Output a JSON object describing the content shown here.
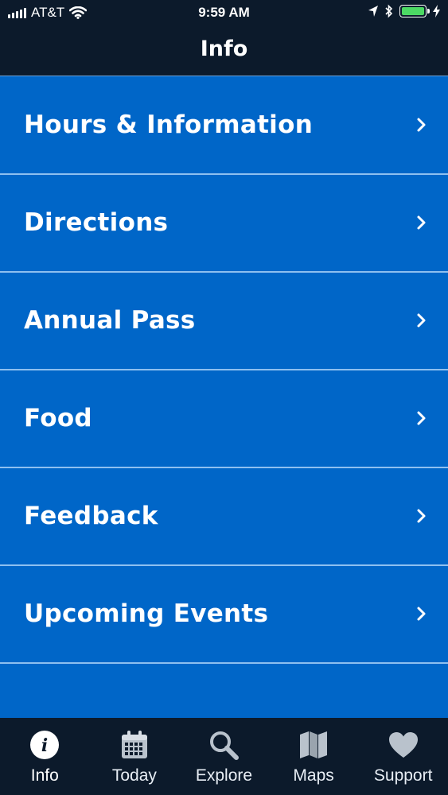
{
  "status_bar": {
    "carrier": "AT&T",
    "time": "9:59 AM",
    "battery_color": "#4cd964",
    "icons": [
      "signal-bars-icon",
      "wifi-icon",
      "location-arrow-icon",
      "bluetooth-icon",
      "battery-icon",
      "charging-bolt-icon"
    ]
  },
  "nav": {
    "title": "Info"
  },
  "menu": {
    "items": [
      {
        "label": "Hours & Information"
      },
      {
        "label": "Directions"
      },
      {
        "label": "Annual Pass"
      },
      {
        "label": "Food"
      },
      {
        "label": "Feedback"
      },
      {
        "label": "Upcoming Events"
      }
    ],
    "chevron_icon": "chevron-right-icon"
  },
  "tab_bar": {
    "tabs": [
      {
        "label": "Info",
        "icon": "info-icon",
        "active": true
      },
      {
        "label": "Today",
        "icon": "calendar-icon",
        "active": false
      },
      {
        "label": "Explore",
        "icon": "search-icon",
        "active": false
      },
      {
        "label": "Maps",
        "icon": "map-icon",
        "active": false
      },
      {
        "label": "Support",
        "icon": "heart-icon",
        "active": false
      }
    ]
  },
  "colors": {
    "background": "#0066c8",
    "bar": "#0c1a2b",
    "divider": "#8ec0f0",
    "text": "#ffffff"
  }
}
